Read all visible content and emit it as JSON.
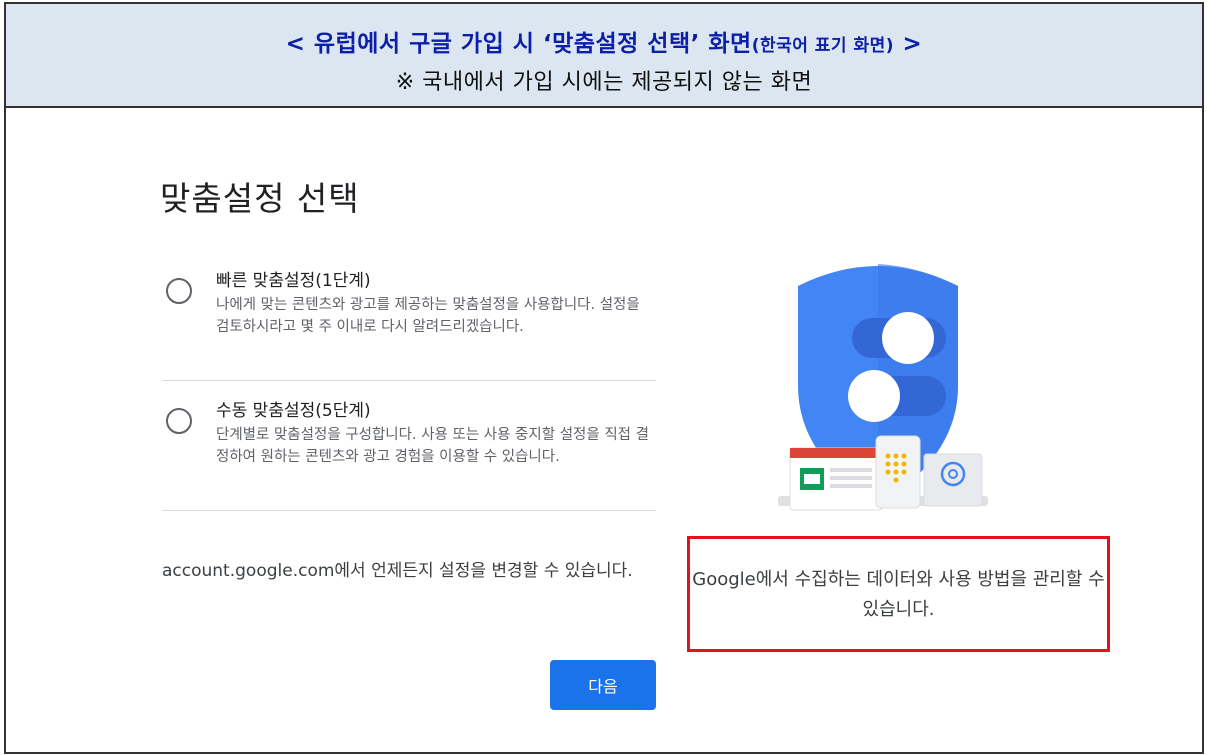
{
  "header": {
    "title_main": "< 유럽에서 구글 가입 시 ‘맞춤설정 선택’ 화면",
    "title_note": "(한국어 표기 화면)",
    "title_end": " >",
    "subtitle": "※ 국내에서 가입 시에는 제공되지 않는 화면"
  },
  "page": {
    "title": "맞춤설정 선택",
    "options": [
      {
        "title": "빠른 맞춤설정(1단계)",
        "description": "나에게 맞는 콘텐츠와 광고를 제공하는 맞춤설정을 사용합니다. 설정을 검토하시라고 몇 주 이내로 다시 알려드리겠습니다.",
        "selected": false
      },
      {
        "title": "수동 맞춤설정(5단계)",
        "description": "단계별로 맞춤설정을 구성합니다. 사용 또는 사용 중지할 설정을 직접 결정하여 원하는 콘텐츠와 광고 경험을 이용할 수 있습니다.",
        "selected": false
      }
    ],
    "footnote": "account.google.com에서 언제든지 설정을 변경할 수 있습니다.",
    "next_label": "다음",
    "caption": "Google에서 수집하는 데이터와 사용 방법을 관리할 수 있습니다."
  },
  "colors": {
    "header_bg": "#dce6f1",
    "header_title": "#0b1fa8",
    "primary_button": "#1a73e8",
    "shield": "#4285f4",
    "highlight_border": "#e0141b"
  },
  "icons": [
    "shield-icon",
    "toggle-icon",
    "browser-window-icon",
    "phone-keypad-icon",
    "email-at-icon"
  ]
}
